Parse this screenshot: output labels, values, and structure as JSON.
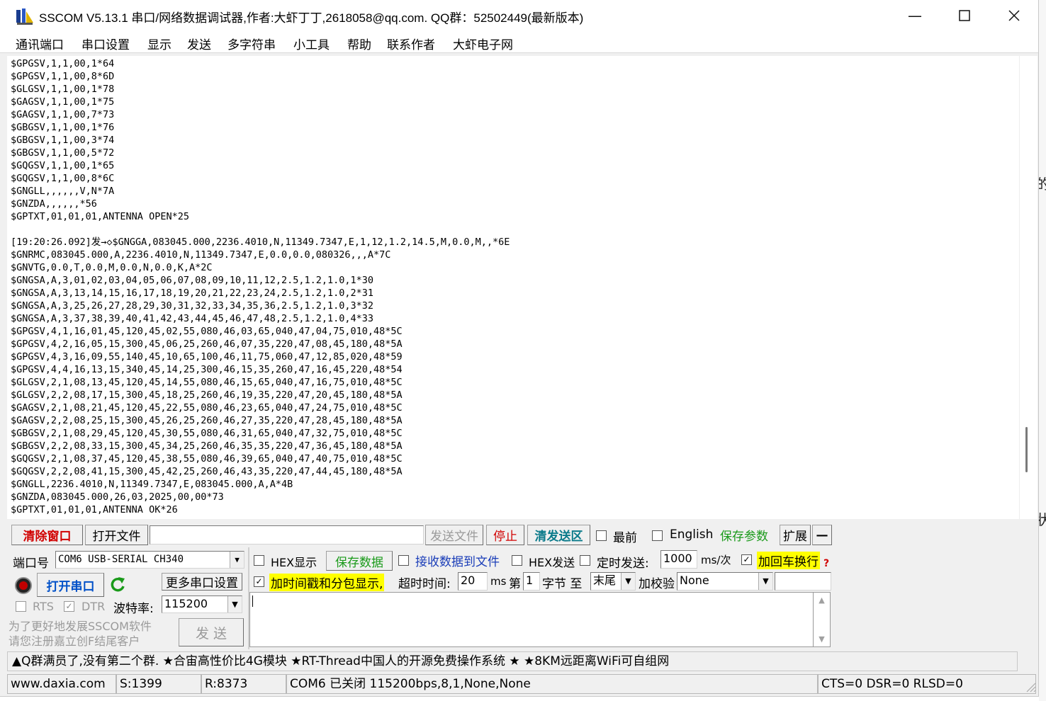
{
  "window": {
    "title": "SSCOM V5.13.1 串口/网络数据调试器,作者:大虾丁丁,2618058@qq.com. QQ群：52502449(最新版本)"
  },
  "menu": [
    "通讯端口",
    "串口设置",
    "显示",
    "发送",
    "多字符串",
    "小工具",
    "帮助",
    "联系作者",
    "大虾电子网"
  ],
  "log": {
    "lines": [
      "$GPGSV,1,1,00,1*64",
      "$GPGSV,1,1,00,8*6D",
      "$GLGSV,1,1,00,1*78",
      "$GAGSV,1,1,00,1*75",
      "$GAGSV,1,1,00,7*73",
      "$GBGSV,1,1,00,1*76",
      "$GBGSV,1,1,00,3*74",
      "$GBGSV,1,1,00,5*72",
      "$GQGSV,1,1,00,1*65",
      "$GQGSV,1,1,00,8*6C",
      "$GNGLL,,,,,,V,N*7A",
      "$GNZDA,,,,,,*56",
      "$GPTXT,01,01,01,ANTENNA OPEN*25",
      "",
      "[19:20:26.092]发→◇$GNGGA,083045.000,2236.4010,N,11349.7347,E,1,12,1.2,14.5,M,0.0,M,,*6E",
      "$GNRMC,083045.000,A,2236.4010,N,11349.7347,E,0.0,0.0,080326,,,A*7C",
      "$GNVTG,0.0,T,0.0,M,0.0,N,0.0,K,A*2C",
      "$GNGSA,A,3,01,02,03,04,05,06,07,08,09,10,11,12,2.5,1.2,1.0,1*30",
      "$GNGSA,A,3,13,14,15,16,17,18,19,20,21,22,23,24,2.5,1.2,1.0,2*31",
      "$GNGSA,A,3,25,26,27,28,29,30,31,32,33,34,35,36,2.5,1.2,1.0,3*32",
      "$GNGSA,A,3,37,38,39,40,41,42,43,44,45,46,47,48,2.5,1.2,1.0,4*33",
      "$GPGSV,4,1,16,01,45,120,45,02,55,080,46,03,65,040,47,04,75,010,48*5C",
      "$GPGSV,4,2,16,05,15,300,45,06,25,260,46,07,35,220,47,08,45,180,48*5A",
      "$GPGSV,4,3,16,09,55,140,45,10,65,100,46,11,75,060,47,12,85,020,48*59",
      "$GPGSV,4,4,16,13,15,340,45,14,25,300,46,15,35,260,47,16,45,220,48*54",
      "$GLGSV,2,1,08,13,45,120,45,14,55,080,46,15,65,040,47,16,75,010,48*5C",
      "$GLGSV,2,2,08,17,15,300,45,18,25,260,46,19,35,220,47,20,45,180,48*5A",
      "$GAGSV,2,1,08,21,45,120,45,22,55,080,46,23,65,040,47,24,75,010,48*5C",
      "$GAGSV,2,2,08,25,15,300,45,26,25,260,46,27,35,220,47,28,45,180,48*5A",
      "$GBGSV,2,1,08,29,45,120,45,30,55,080,46,31,65,040,47,32,75,010,48*5C",
      "$GBGSV,2,2,08,33,15,300,45,34,25,260,46,35,35,220,47,36,45,180,48*5A",
      "$GQGSV,2,1,08,37,45,120,45,38,55,080,46,39,65,040,47,40,75,010,48*5C",
      "$GQGSV,2,2,08,41,15,300,45,42,25,260,46,43,35,220,47,44,45,180,48*5A",
      "$GNGLL,2236.4010,N,11349.7347,E,083045.000,A,A*4B",
      "$GNZDA,083045.000,26,03,2025,00,00*73",
      "$GPTXT,01,01,01,ANTENNA OK*26"
    ]
  },
  "toolbar": {
    "clear": "清除窗口",
    "open_file": "打开文件",
    "file_path": "",
    "send_file": "发送文件",
    "stop": "停止",
    "clear_send": "清发送区",
    "topmost": "最前",
    "english": "English",
    "save_params": "保存参数",
    "expand": "扩展",
    "collapse": "—"
  },
  "port": {
    "label": "端口号",
    "selected": "COM6 USB-SERIAL CH340",
    "open_button": "打开串口",
    "more_settings": "更多串口设置",
    "rts": "RTS",
    "dtr": "DTR",
    "dtr_checked": true,
    "rts_checked": false,
    "baud_label": "波特率:",
    "baud": "115200",
    "promo": "为了更好地发展SSCOM软件\n请您注册嘉立创F结尾客户",
    "send_button": "发  送"
  },
  "options": {
    "hex_display": "HEX显示",
    "save_data": "保存数据",
    "recv_to_file": "接收数据到文件",
    "hex_send": "HEX发送",
    "timed_send": "定时发送:",
    "interval": "1000",
    "interval_unit": "ms/次",
    "append_newline": "加回车换行",
    "append_newline_checked": true,
    "timestamp": "加时间戳和分包显示,",
    "timestamp_checked": true,
    "timeout_label": "超时时间:",
    "timeout": "20",
    "timeout_unit": "ms",
    "byte_prefix": "第",
    "byte_index": "1",
    "byte_suffix": "字节 至",
    "end_select": "末尾",
    "checksum_label": "加校验",
    "checksum": "None",
    "help_mark": "?"
  },
  "send_text": "",
  "ticker": "▲Q群满员了,没有第二个群. ★合宙高性价比4G模块 ★RT-Thread中国人的开源免费操作系统 ★ ★8KM远距离WiFi可自组网",
  "status": {
    "site": "www.daxia.com",
    "sent": "S:1399",
    "received": "R:8373",
    "port_state": "COM6 已关闭  115200bps,8,1,None,None",
    "lines": "CTS=0 DSR=0 RLSD=0"
  },
  "colors": {
    "red": "#d10000",
    "blue": "#0050c8",
    "green": "#1a9a1a",
    "highlight": "#ffff00"
  }
}
